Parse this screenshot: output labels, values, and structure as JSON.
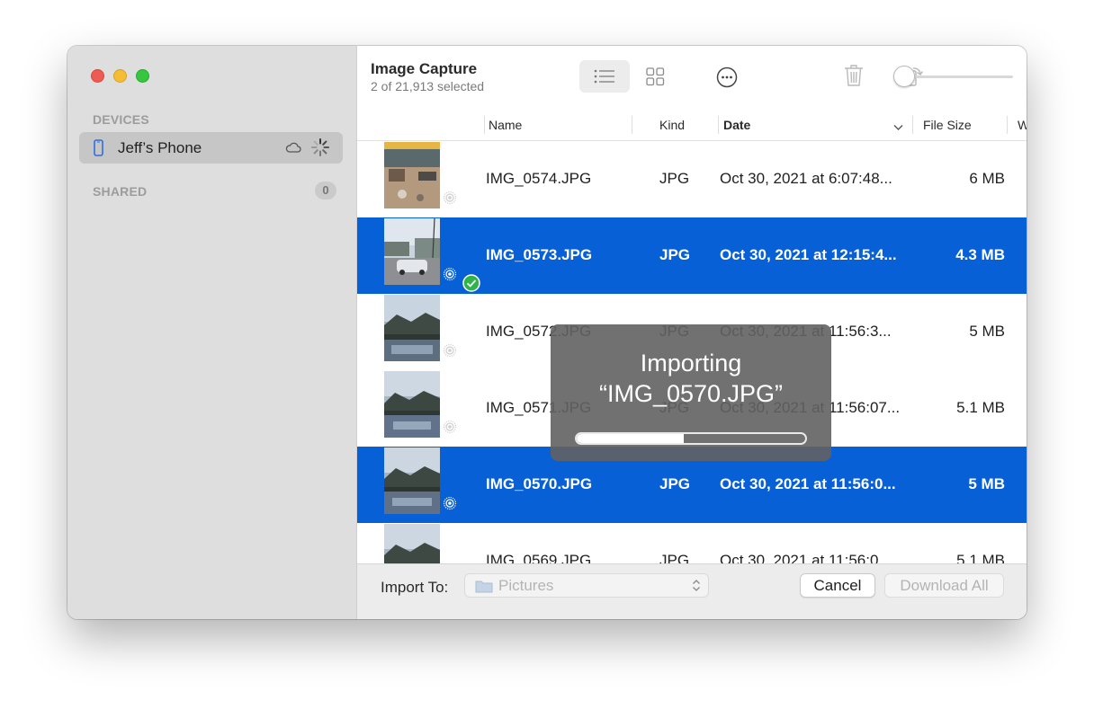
{
  "window": {
    "title": "Image Capture",
    "subtitle": "2 of 21,913 selected"
  },
  "sidebar": {
    "devices_heading": "DEVICES",
    "device_name": "Jeff’s Phone",
    "shared_heading": "SHARED",
    "shared_count": "0"
  },
  "toolbar": {
    "icons": [
      "list-view-icon",
      "grid-view-icon",
      "more-options-icon",
      "trash-icon",
      "rotate-icon",
      "thumbnail-size-slider"
    ],
    "thumbnail_size": 0
  },
  "table": {
    "columns": [
      "Name",
      "Kind",
      "Date",
      "File Size",
      "W"
    ],
    "sorted_by": "Date",
    "rows": [
      {
        "name": "IMG_0574.JPG",
        "kind": "JPG",
        "date": "Oct 30, 2021 at 6:07:48...",
        "size": "6 MB",
        "selected": false,
        "imported": false
      },
      {
        "name": "IMG_0573.JPG",
        "kind": "JPG",
        "date": "Oct 30, 2021 at 12:15:4...",
        "size": "4.3 MB",
        "selected": true,
        "imported": true
      },
      {
        "name": "IMG_0572.JPG",
        "kind": "JPG",
        "date": "Oct 30, 2021 at 11:56:3...",
        "size": "5 MB",
        "selected": false,
        "imported": false
      },
      {
        "name": "IMG_0571.JPG",
        "kind": "JPG",
        "date": "Oct 30, 2021 at 11:56:07...",
        "size": "5.1 MB",
        "selected": false,
        "imported": false
      },
      {
        "name": "IMG_0570.JPG",
        "kind": "JPG",
        "date": "Oct 30, 2021 at 11:56:0...",
        "size": "5 MB",
        "selected": true,
        "imported": false
      },
      {
        "name": "IMG_0569.JPG",
        "kind": "JPG",
        "date": "Oct 30, 2021 at 11:56:0...",
        "size": "5.1 MB",
        "selected": false,
        "imported": false
      }
    ]
  },
  "bottom": {
    "import_label": "Import To:",
    "folder": "Pictures",
    "cancel": "Cancel",
    "download_all": "Download All"
  },
  "progress": {
    "title": "Importing",
    "file": "“IMG_0570.JPG”",
    "fraction": 0.47
  },
  "colors": {
    "selection": "#0860d6",
    "accent_check": "#2fb34b"
  }
}
